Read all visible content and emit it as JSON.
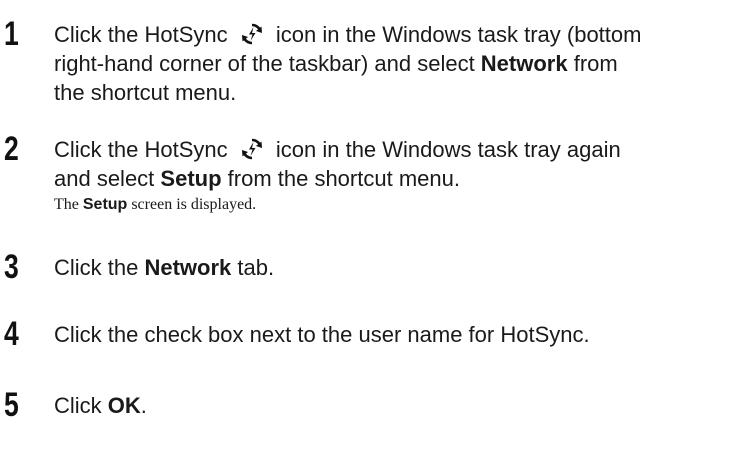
{
  "steps": [
    {
      "number": "1",
      "pre_icon": "Click the HotSync",
      "icon": "hotsync-icon",
      "line1_rest": "icon in the Windows task tray (bottom",
      "line2": "right-hand corner of the taskbar) and select ",
      "bold": "Network",
      "after_bold": " from",
      "line3": "the shortcut menu."
    },
    {
      "number": "2",
      "pre_icon": "Click the HotSync",
      "icon": "hotsync-icon",
      "line1_rest": "icon in the Windows task tray again",
      "line2_pre": "and select ",
      "bold": "Setup",
      "line2_post": " from the shortcut menu.",
      "note_pre": "The ",
      "note_bold": "Setup",
      "note_post": " screen is displayed."
    },
    {
      "number": "3",
      "pre": "Click the ",
      "bold": "Network",
      "post": " tab."
    },
    {
      "number": "4",
      "text": "Click the check box next to the user name for HotSync."
    },
    {
      "number": "5",
      "pre": "Click ",
      "bold": "OK",
      "post": "."
    }
  ],
  "colors": {
    "text": "#1a1a1a",
    "icon": "#111111"
  }
}
